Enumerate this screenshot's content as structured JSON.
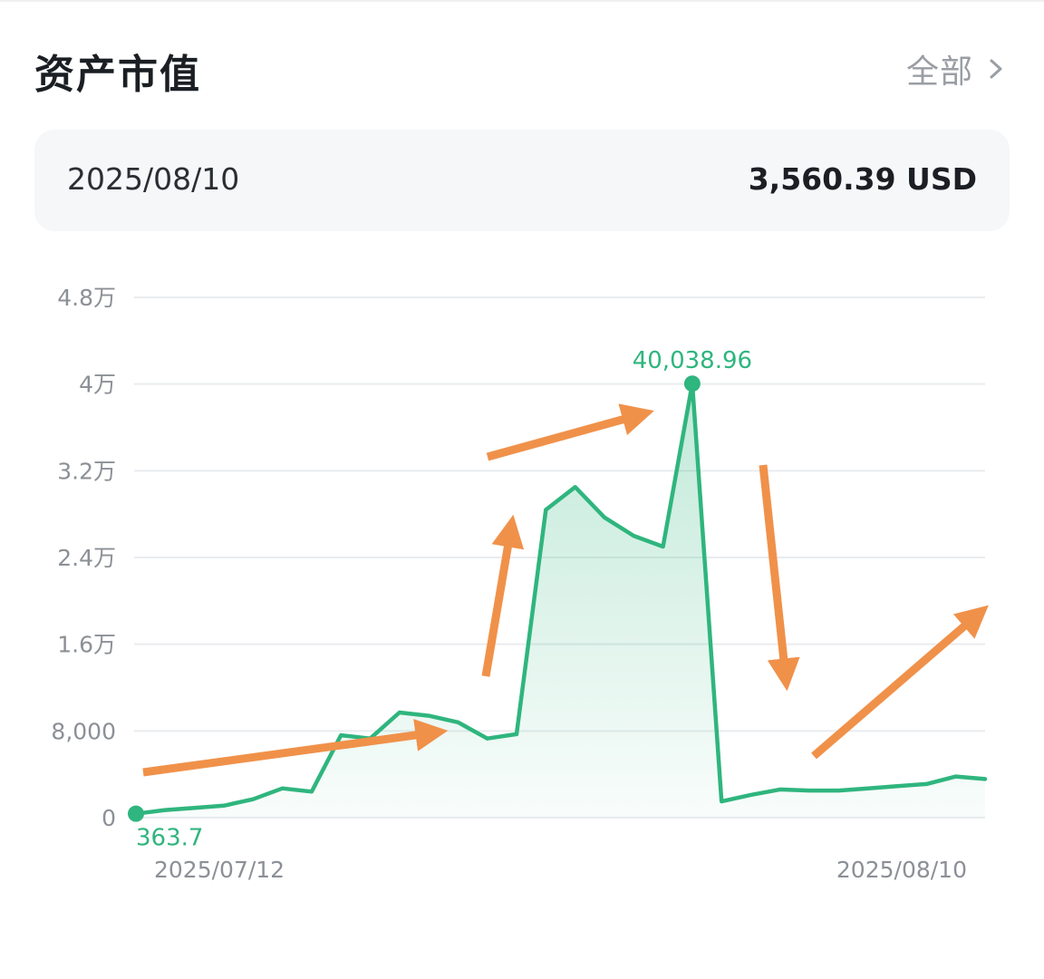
{
  "header": {
    "title": "资产市值",
    "all_label": "全部"
  },
  "summary": {
    "date": "2025/08/10",
    "value": "3,560.39 USD"
  },
  "icons": {
    "chevron": "chevron-right-icon"
  },
  "colors": {
    "line": "#2fb57e",
    "fill": "#2fb57e",
    "grid": "#e9ecef",
    "annotation_arrow": "#f0914a"
  },
  "chart_data": {
    "type": "area",
    "title": "",
    "xlabel": "",
    "ylabel": "",
    "ylim": [
      0,
      48000
    ],
    "y_ticks": [
      0,
      8000,
      16000,
      24000,
      32000,
      40000,
      48000
    ],
    "y_tick_labels": [
      "0",
      "8,000",
      "1.6万",
      "2.4万",
      "3.2万",
      "4万",
      "4.8万"
    ],
    "x_range": [
      "2025/07/12",
      "2025/08/10"
    ],
    "x_tick_labels": [
      "2025/07/12",
      "2025/08/10"
    ],
    "grid": true,
    "series": [
      {
        "values": [
          363.7,
          700,
          900,
          1100,
          1700,
          2700,
          2400,
          7600,
          7300,
          9700,
          9400,
          8800,
          7300,
          7700,
          28400,
          30500,
          27700,
          26000,
          25000,
          40038.96,
          1500,
          2100,
          2600,
          2500,
          2500,
          2700,
          2900,
          3100,
          3800,
          3560.39
        ]
      }
    ],
    "min_label": "363.7",
    "max_label": "40,038.96"
  }
}
